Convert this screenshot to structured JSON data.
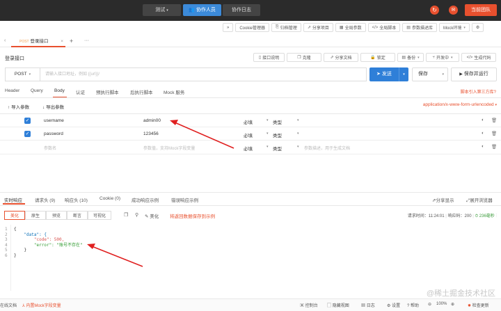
{
  "topbar": {
    "test_label": "测试",
    "collab_label": "协作人员",
    "log_label": "协作日志",
    "team_label": "当前团队"
  },
  "toolbar": {
    "items": [
      "Cookie管理器",
      "归档管理",
      "分享项目",
      "全局参数",
      "全局脚本",
      "参数描述库",
      "Mock环境"
    ]
  },
  "request_tabs": {
    "active_tab": "登录接口",
    "active_method_tag": "POST",
    "add": "+",
    "more": "···"
  },
  "api": {
    "name": "登录接口",
    "actions": [
      "接口说明",
      "克隆",
      "分享文档",
      "锁定",
      "备份",
      "开发中",
      "生成代码"
    ],
    "method": "POST",
    "url_placeholder": "请输入接口地址，例如 {{url}}/",
    "send_label": "发送",
    "save_label": "保存",
    "save_run_label": "保存并运行"
  },
  "param_tabs": {
    "items": [
      "Header",
      "Query",
      "Body",
      "认证",
      "预执行脚本",
      "后执行脚本",
      "Mock 服务"
    ],
    "active": "Body",
    "right_link": "脚本引入第三方库?"
  },
  "body": {
    "import_label": "导入参数",
    "export_label": "导出参数",
    "content_type": "application/x-www-form-urlencoded",
    "rows": [
      {
        "key": "username",
        "value": "admin00",
        "required": "必填",
        "type": "类型",
        "desc": ""
      },
      {
        "key": "password",
        "value": "123456",
        "required": "必填",
        "type": "类型",
        "desc": ""
      }
    ],
    "empty_row": {
      "key": "参数名",
      "value": "参数值，支持Mock字段变量",
      "required": "必填",
      "type": "类型",
      "desc": "参数描述，用于生成文档"
    }
  },
  "response_tabs": {
    "items": [
      "实时响应",
      "请求头 (9)",
      "响应头 (10)",
      "Cookie (0)",
      "成功响应示例",
      "错误响应示例"
    ],
    "active": "实时响应",
    "share_label": "分享显示",
    "expand_label": "展开浏览器"
  },
  "response_view": {
    "modes": [
      "美化",
      "原生",
      "预览",
      "断言",
      "可视化"
    ],
    "active_mode": "美化",
    "beautify_label": "美化",
    "save_example_link": "将返回数据保存到示例",
    "time_label": "请求时间：11:24:01",
    "status_label": "响应码：200",
    "duration_label": "236毫秒"
  },
  "response_code": {
    "lines": [
      "{",
      "    \"data\": {",
      "        \"code\": 500,",
      "        \"error\": \"账号不存在\"",
      "    }",
      "}"
    ],
    "line_numbers": [
      "1",
      "2",
      "3",
      "4",
      "5",
      "6"
    ]
  },
  "statusbar": {
    "left": [
      "在线文档",
      "内置Mock字段变量"
    ],
    "right": [
      "控制台",
      "隐藏视图",
      "日志",
      "设置",
      "帮助",
      "100%",
      "检查更新"
    ]
  },
  "watermark": "@稀土掘金技术社区",
  "colors": {
    "primary": "#2f7fd8",
    "danger": "#e8502e",
    "topbar": "#2b2b2b"
  }
}
